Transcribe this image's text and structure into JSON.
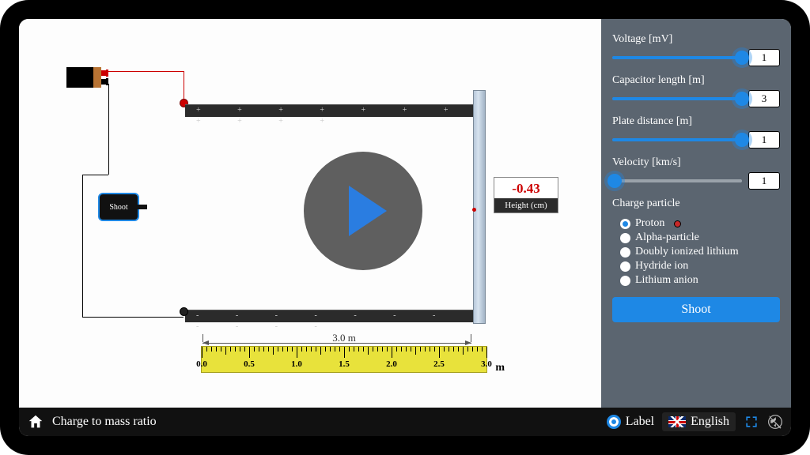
{
  "title": "Charge to mass ratio",
  "bottom": {
    "label_toggle": "Label",
    "language": "English"
  },
  "controls": {
    "voltage": {
      "label": "Voltage [mV]",
      "value": "1",
      "fill_pct": 100
    },
    "cap_len": {
      "label": "Capacitor length [m]",
      "value": "3",
      "fill_pct": 100
    },
    "plate_dist": {
      "label": "Plate distance [m]",
      "value": "1",
      "fill_pct": 100
    },
    "velocity": {
      "label": "Velocity [km/s]",
      "value": "1",
      "fill_pct": 2
    },
    "particle_label": "Charge particle",
    "particles": [
      "Proton",
      "Alpha-particle",
      "Doubly ionized lithium",
      "Hydride ion",
      "Lithium anion"
    ],
    "selected_particle": 0,
    "shoot_label": "Shoot"
  },
  "sim": {
    "shooter_label": "Shoot",
    "readout_value": "-0.43",
    "readout_label": "Height (cm)",
    "ruler_caption": "3.0 m",
    "ruler_unit": "m",
    "ruler_ticks": [
      "0.0",
      "0.5",
      "1.0",
      "1.5",
      "2.0",
      "2.5",
      "3.0"
    ]
  }
}
